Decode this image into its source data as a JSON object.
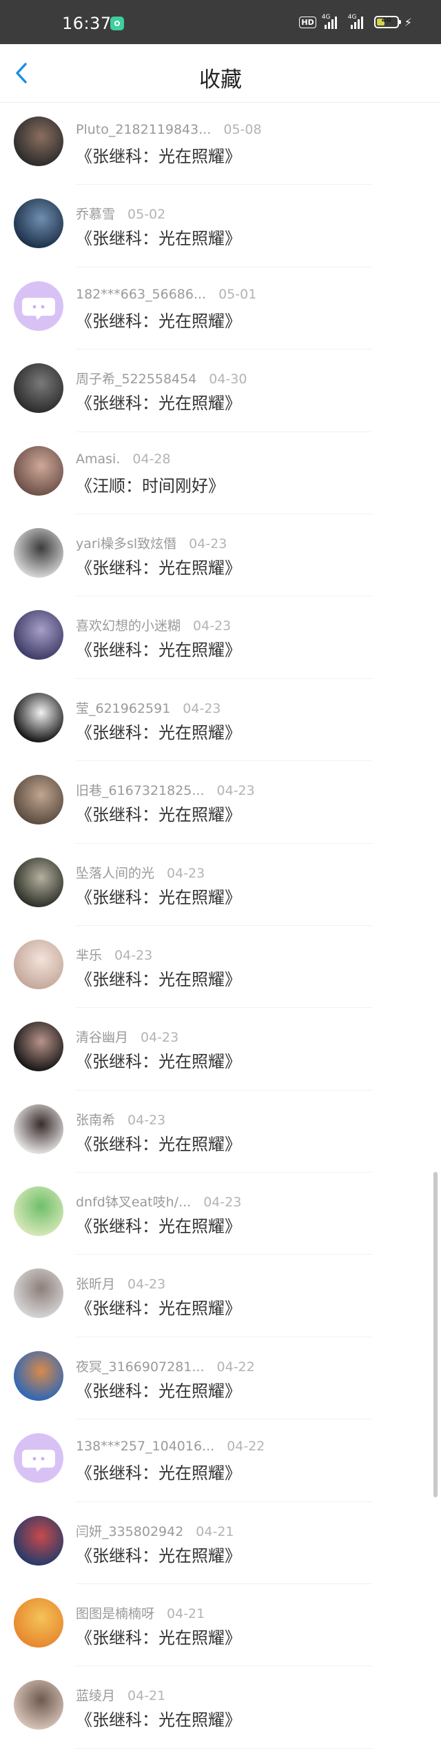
{
  "status_bar": {
    "time": "16:37",
    "hd_label": "HD",
    "signal1_tag": "4G",
    "signal2_tag": "4G",
    "battery_level": "40"
  },
  "header": {
    "title": "收藏",
    "back_icon": "chevron-left-icon"
  },
  "colors": {
    "accent": "#1e8fe0",
    "meta_text": "#9a9a9a",
    "title_text": "#333333",
    "placeholder_avatar": "#d8c2f5"
  },
  "favorites": [
    {
      "user": "Pluto_2182119843...",
      "date": "05-08",
      "song": "《张继科：光在照耀》",
      "avatar": [
        "#2a2a2a",
        "#8a6f60"
      ]
    },
    {
      "user": "乔慕雪",
      "date": "05-02",
      "song": "《张继科：光在照耀》",
      "avatar": [
        "#1d2f48",
        "#6f8fb0"
      ]
    },
    {
      "user": "182***663_56686...",
      "date": "05-01",
      "song": "《张继科：光在照耀》",
      "avatar": "placeholder"
    },
    {
      "user": "周子希_522558454",
      "date": "04-30",
      "song": "《张继科：光在照耀》",
      "avatar": [
        "#2b2b2b",
        "#7a7a7a"
      ]
    },
    {
      "user": "Amasi.",
      "date": "04-28",
      "song": "《汪顺：时间刚好》",
      "avatar": [
        "#6b4f46",
        "#cfa89a"
      ]
    },
    {
      "user": "yari橾多sl致炫僭",
      "date": "04-23",
      "song": "《张继科：光在照耀》",
      "avatar": [
        "#d8d8d8",
        "#3c3c3c"
      ]
    },
    {
      "user": "喜欢幻想的小迷糊",
      "date": "04-23",
      "song": "《张继科：光在照耀》",
      "avatar": [
        "#3c3a66",
        "#a7a0c8"
      ]
    },
    {
      "user": "莹_621962591",
      "date": "04-23",
      "song": "《张继科：光在照耀》",
      "avatar": [
        "#111111",
        "#f2f2f2"
      ]
    },
    {
      "user": "旧巷_6167321825...",
      "date": "04-23",
      "song": "《张继科：光在照耀》",
      "avatar": [
        "#5a4a3e",
        "#c0a690"
      ]
    },
    {
      "user": "坠落人间的光",
      "date": "04-23",
      "song": "《张继科：光在照耀》",
      "avatar": [
        "#2a2e25",
        "#b6b1a0"
      ]
    },
    {
      "user": "芈乐",
      "date": "04-23",
      "song": "《张继科：光在照耀》",
      "avatar": [
        "#c4a79a",
        "#f3e3da"
      ]
    },
    {
      "user": "清谷幽月",
      "date": "04-23",
      "song": "《张继科：光在照耀》",
      "avatar": [
        "#141414",
        "#b9948a"
      ]
    },
    {
      "user": "张南希",
      "date": "04-23",
      "song": "《张继科：光在照耀》",
      "avatar": [
        "#e8e6e6",
        "#3a2c2c"
      ]
    },
    {
      "user": "dnfd钵叉eat吱h/...",
      "date": "04-23",
      "song": "《张继科：光在照耀》",
      "avatar": [
        "#d7e8b9",
        "#6fbf6a"
      ]
    },
    {
      "user": "张昕月",
      "date": "04-23",
      "song": "《张继科：光在照耀》",
      "avatar": [
        "#d6d6d6",
        "#8e7f7a"
      ]
    },
    {
      "user": "夜冥_3166907281...",
      "date": "04-22",
      "song": "《张继科：光在照耀》",
      "avatar": [
        "#2a66b8",
        "#d98a4a"
      ]
    },
    {
      "user": "138***257_104016...",
      "date": "04-22",
      "song": "《张继科：光在照耀》",
      "avatar": "placeholder"
    },
    {
      "user": "闫妍_335802942",
      "date": "04-21",
      "song": "《张继科：光在照耀》",
      "avatar": [
        "#233a6a",
        "#c84a4a"
      ]
    },
    {
      "user": "图图是楠楠呀",
      "date": "04-21",
      "song": "《张继科：光在照耀》",
      "avatar": [
        "#e7862c",
        "#f4c35a"
      ]
    },
    {
      "user": "蓝绫月",
      "date": "04-21",
      "song": "《张继科：光在照耀》",
      "avatar": [
        "#d9c4b8",
        "#6e5a50"
      ]
    }
  ]
}
